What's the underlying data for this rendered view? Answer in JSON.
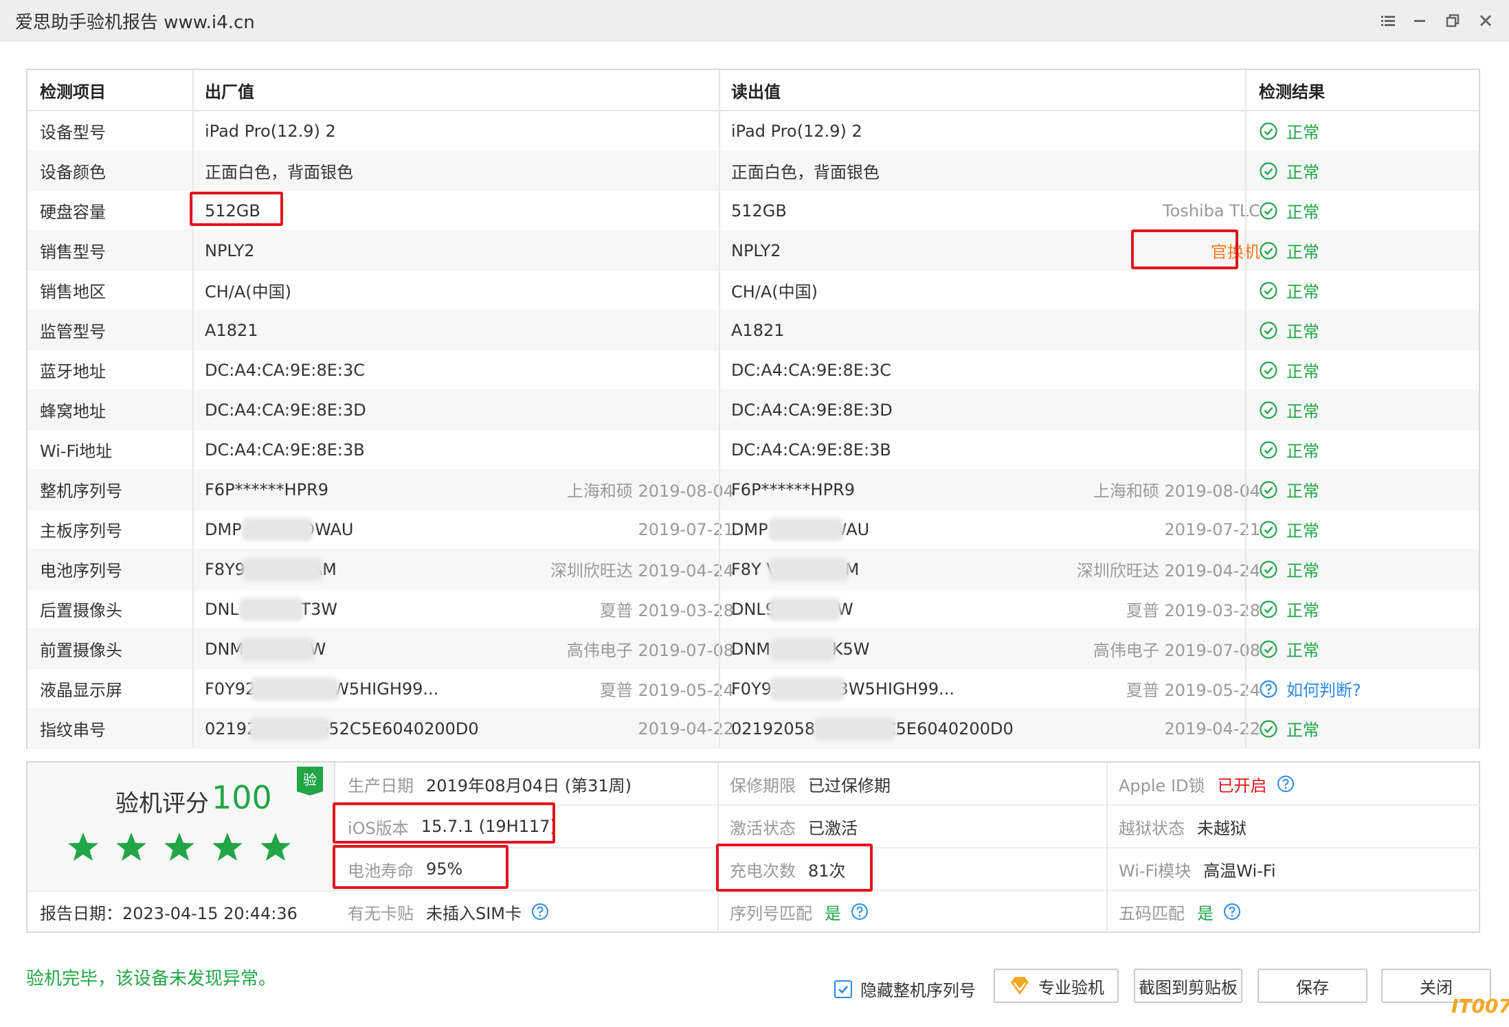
{
  "window": {
    "title": "爱思助手验机报告 www.i4.cn"
  },
  "table": {
    "headers": [
      "检测项目",
      "出厂值",
      "读出值",
      "检测结果"
    ],
    "rows": [
      {
        "item": "设备型号",
        "factory": "iPad Pro(12.9) 2",
        "factory_meta": "",
        "read": "iPad Pro(12.9) 2",
        "read_meta": "",
        "result": "正常"
      },
      {
        "item": "设备颜色",
        "factory": "正面白色，背面银色",
        "factory_meta": "",
        "read": "正面白色，背面银色",
        "read_meta": "",
        "result": "正常"
      },
      {
        "item": "硬盘容量",
        "factory": "512GB",
        "factory_meta": "",
        "read": "512GB",
        "read_meta": "Toshiba TLC",
        "result": "正常"
      },
      {
        "item": "销售型号",
        "factory": "NPLY2",
        "factory_meta": "",
        "read": "NPLY2",
        "read_meta": "官换机",
        "result": "正常"
      },
      {
        "item": "销售地区",
        "factory": "CH/A(中国)",
        "factory_meta": "",
        "read": "CH/A(中国)",
        "read_meta": "",
        "result": "正常"
      },
      {
        "item": "监管型号",
        "factory": "A1821",
        "factory_meta": "",
        "read": "A1821",
        "read_meta": "",
        "result": "正常"
      },
      {
        "item": "蓝牙地址",
        "factory": "DC:A4:CA:9E:8E:3C",
        "factory_meta": "",
        "read": "DC:A4:CA:9E:8E:3C",
        "read_meta": "",
        "result": "正常"
      },
      {
        "item": "蜂窝地址",
        "factory": "DC:A4:CA:9E:8E:3D",
        "factory_meta": "",
        "read": "DC:A4:CA:9E:8E:3D",
        "read_meta": "",
        "result": "正常"
      },
      {
        "item": "Wi-Fi地址",
        "factory": "DC:A4:CA:9E:8E:3B",
        "factory_meta": "",
        "read": "DC:A4:CA:9E:8E:3B",
        "read_meta": "",
        "result": "正常"
      },
      {
        "item": "整机序列号",
        "factory": "F6P******HPR9",
        "factory_meta": "上海和硕 2019-08-04",
        "read": "F6P******HPR9",
        "read_meta": "上海和硕 2019-08-04",
        "result": "正常"
      },
      {
        "item": "主板序列号",
        "factory": "DMP         003HXDWAU",
        "factory_meta": "2019-07-21",
        "read": "DMP         03HXDWAU",
        "read_meta": "2019-07-21",
        "result": "正常"
      },
      {
        "item": "电池序列号",
        "factory": "F8Y9          'HH1YCAM",
        "factory_meta": "深圳欣旺达 2019-04-24",
        "read": "F8Y            VHH1YCAM",
        "read_meta": "深圳欣旺达 2019-04-24",
        "result": "正常"
      },
      {
        "item": "后置摄像头",
        "factory": "DNL          67H1HT3W",
        "factory_meta": "夏普 2019-03-28",
        "read": "DNL9            H1HT3W",
        "read_meta": "夏普 2019-03-28",
        "result": "正常"
      },
      {
        "item": "前置摄像头",
        "factory": "DNM          VH1JK5W",
        "factory_meta": "高伟电子 2019-07-08",
        "read": "DNM          'GVH1JK5W",
        "read_meta": "高伟电子 2019-07-08",
        "result": "正常"
      },
      {
        "item": "液晶显示屏",
        "factory": "F0Y92         GXMCA3W5HIGH99...",
        "factory_meta": "夏普 2019-05-24",
        "read": "F0Y9          GXMCA3W5HIGH99...",
        "read_meta": "夏普 2019-05-24",
        "result": "如何判断?"
      },
      {
        "item": "指纹串号",
        "factory": "02192            D42C8652C5E6040200D0",
        "factory_meta": "2019-04-22",
        "read": "02192058        2C8652C5E6040200D0",
        "read_meta": "2019-04-22",
        "result": "正常"
      }
    ]
  },
  "summary": {
    "score_label": "验机评分",
    "score_value": "100",
    "badge": "验",
    "stars": 5,
    "report_date": "报告日期：2023-04-15 20:44:36",
    "production_date": {
      "label": "生产日期",
      "value": "2019年08月04日 (第31周)"
    },
    "warranty": {
      "label": "保修期限",
      "value": "已过保修期"
    },
    "apple_id": {
      "label": "Apple ID锁",
      "value": "已开启"
    },
    "ios": {
      "label": "iOS版本",
      "value": "15.7.1 (19H117)"
    },
    "activation": {
      "label": "激活状态",
      "value": "已激活"
    },
    "jailbreak": {
      "label": "越狱状态",
      "value": "未越狱"
    },
    "battery": {
      "label": "电池寿命",
      "value": "95%"
    },
    "charge_count": {
      "label": "充电次数",
      "value": "81次"
    },
    "wifi_module": {
      "label": "Wi-Fi模块",
      "value": "高温Wi-Fi"
    },
    "sim": {
      "label": "有无卡贴",
      "value": "未插入SIM卡"
    },
    "serial_match": {
      "label": "序列号匹配",
      "value": "是"
    },
    "five_code_match": {
      "label": "五码匹配",
      "value": "是"
    }
  },
  "footer": {
    "status": "验机完毕，该设备未发现异常。",
    "hide_serial_label": "隐藏整机序列号",
    "hide_serial_checked": true,
    "pro_button": "专业验机",
    "screenshot_button": "截图到剪贴板",
    "save_button": "保存",
    "close_button": "关闭",
    "watermark": "IT007"
  },
  "colors": {
    "green": "#21a547",
    "red": "#e0141c",
    "orange": "#f57b20",
    "blue": "#2c8ae8"
  }
}
